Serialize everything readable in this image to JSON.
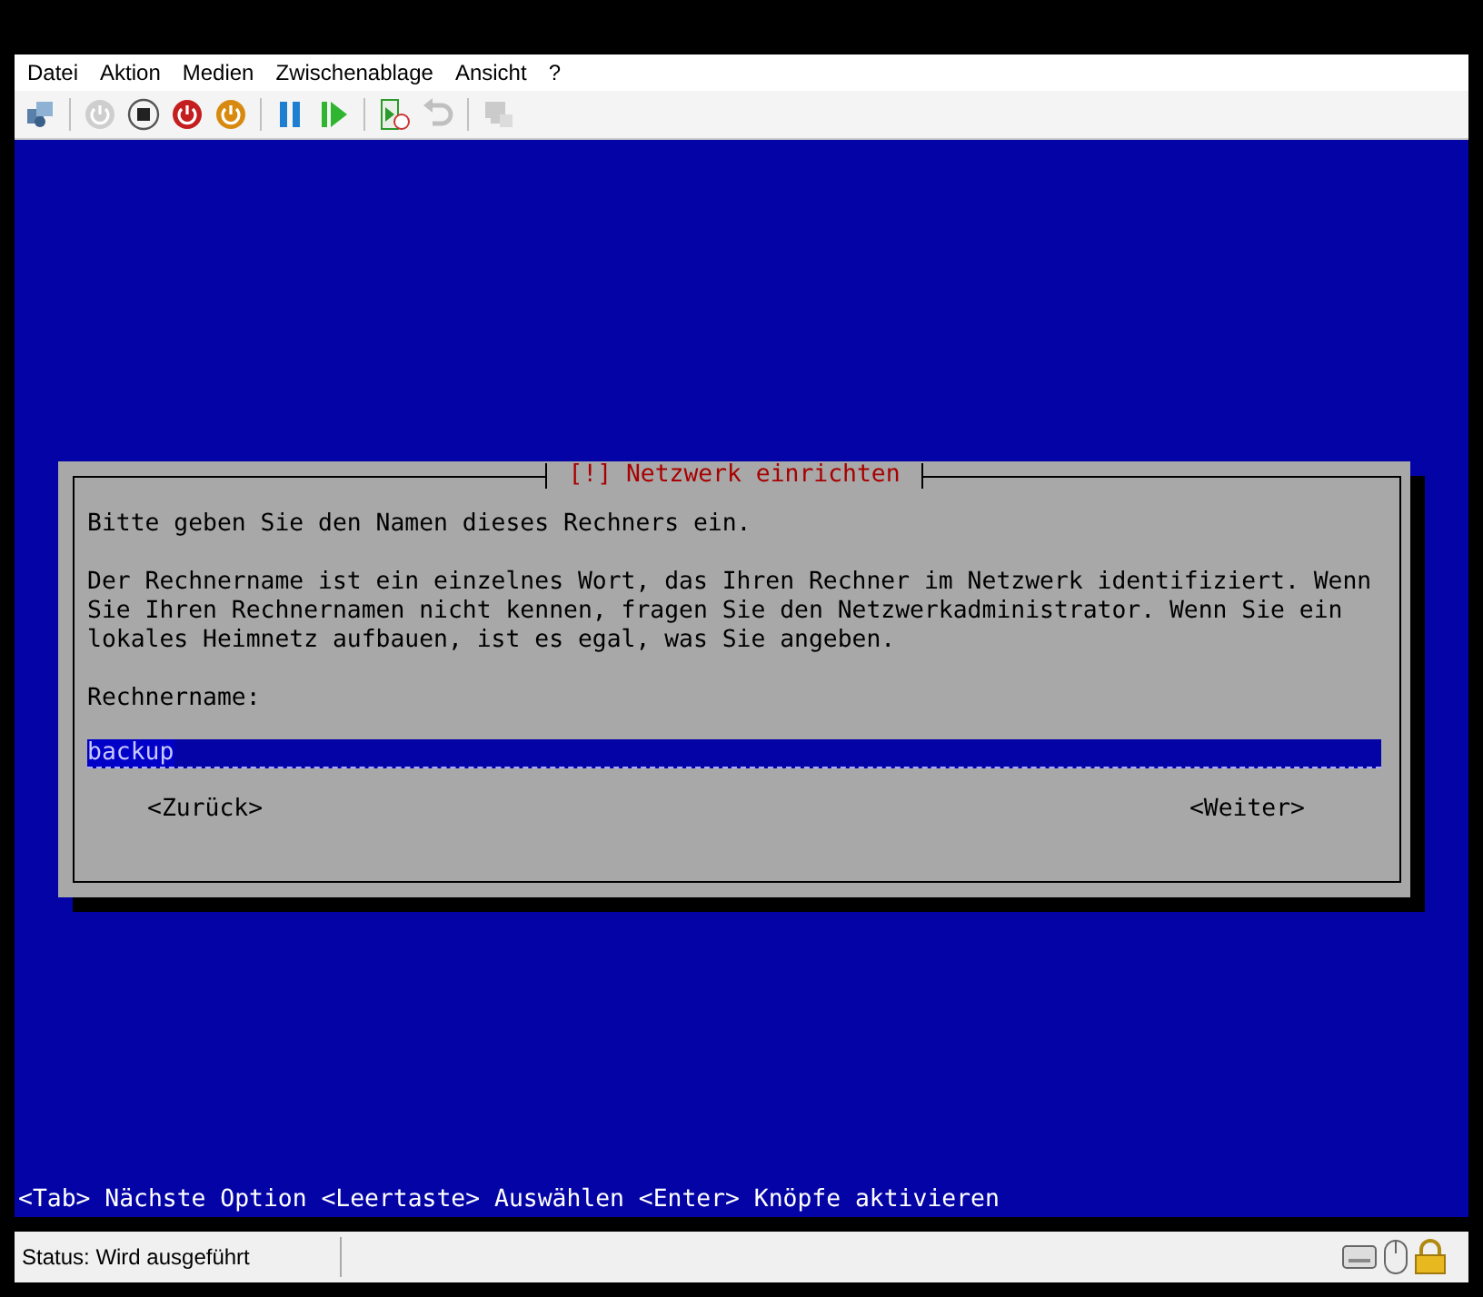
{
  "menu": [
    "Datei",
    "Aktion",
    "Medien",
    "Zwischenablage",
    "Ansicht",
    "?"
  ],
  "toolbar": [
    {
      "kind": "connect",
      "disabled": false
    },
    {
      "kind": "separator"
    },
    {
      "kind": "start",
      "disabled": true
    },
    {
      "kind": "stop",
      "disabled": false
    },
    {
      "kind": "shutdown",
      "disabled": false
    },
    {
      "kind": "save",
      "disabled": false
    },
    {
      "kind": "separator"
    },
    {
      "kind": "pause",
      "disabled": false
    },
    {
      "kind": "reset",
      "disabled": false
    },
    {
      "kind": "separator"
    },
    {
      "kind": "checkpoint",
      "disabled": false
    },
    {
      "kind": "revert",
      "disabled": true
    },
    {
      "kind": "separator"
    },
    {
      "kind": "enhanced",
      "disabled": true
    }
  ],
  "dialog": {
    "title": "[!] Netzwerk einrichten",
    "prompt": "Bitte geben Sie den Namen dieses Rechners ein.",
    "description": "Der Rechnername ist ein einzelnes Wort, das Ihren Rechner im Netzwerk identifiziert. Wenn Sie Ihren Rechnernamen nicht kennen, fragen Sie den Netzwerkadministrator. Wenn Sie ein lokales Heimnetz aufbauen, ist es egal, was Sie angeben.",
    "field_label": "Rechnername:",
    "field_value": "backup",
    "buttons": [
      "<Zurück>",
      "<Weiter>"
    ]
  },
  "hint_line": "<Tab> Nächste Option <Leertaste> Auswählen <Enter> Knöpfe aktivieren",
  "status_bar": {
    "text": "Status: Wird ausgeführt"
  }
}
